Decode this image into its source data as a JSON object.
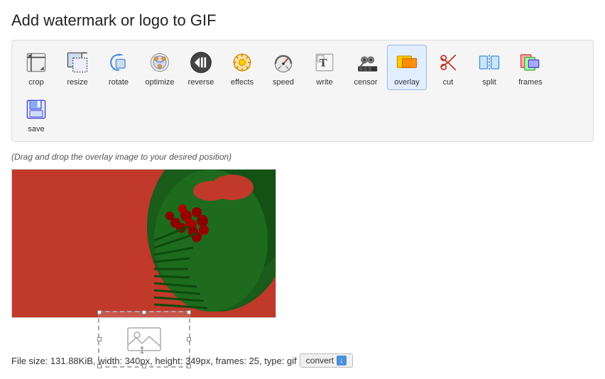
{
  "page": {
    "title": "Add watermark or logo to GIF"
  },
  "toolbar": {
    "tools": [
      {
        "id": "crop",
        "label": "crop",
        "active": false
      },
      {
        "id": "resize",
        "label": "resize",
        "active": false
      },
      {
        "id": "rotate",
        "label": "rotate",
        "active": false
      },
      {
        "id": "optimize",
        "label": "optimize",
        "active": false
      },
      {
        "id": "reverse",
        "label": "reverse",
        "active": false
      },
      {
        "id": "effects",
        "label": "effects",
        "active": false
      },
      {
        "id": "speed",
        "label": "speed",
        "active": false
      },
      {
        "id": "write",
        "label": "write",
        "active": false
      },
      {
        "id": "censor",
        "label": "censor",
        "active": false
      },
      {
        "id": "overlay",
        "label": "overlay",
        "active": true
      },
      {
        "id": "cut",
        "label": "cut",
        "active": false
      },
      {
        "id": "split",
        "label": "split",
        "active": false
      },
      {
        "id": "frames",
        "label": "frames",
        "active": false
      },
      {
        "id": "save",
        "label": "save",
        "active": false
      }
    ]
  },
  "drag_hint": "(Drag and drop the overlay image to your desired position)",
  "footer": {
    "text": "File size: 131.88KiB, width: 340px, height: 349px, frames: 25, type: gif",
    "convert_label": "convert",
    "download_icon": "↓"
  }
}
